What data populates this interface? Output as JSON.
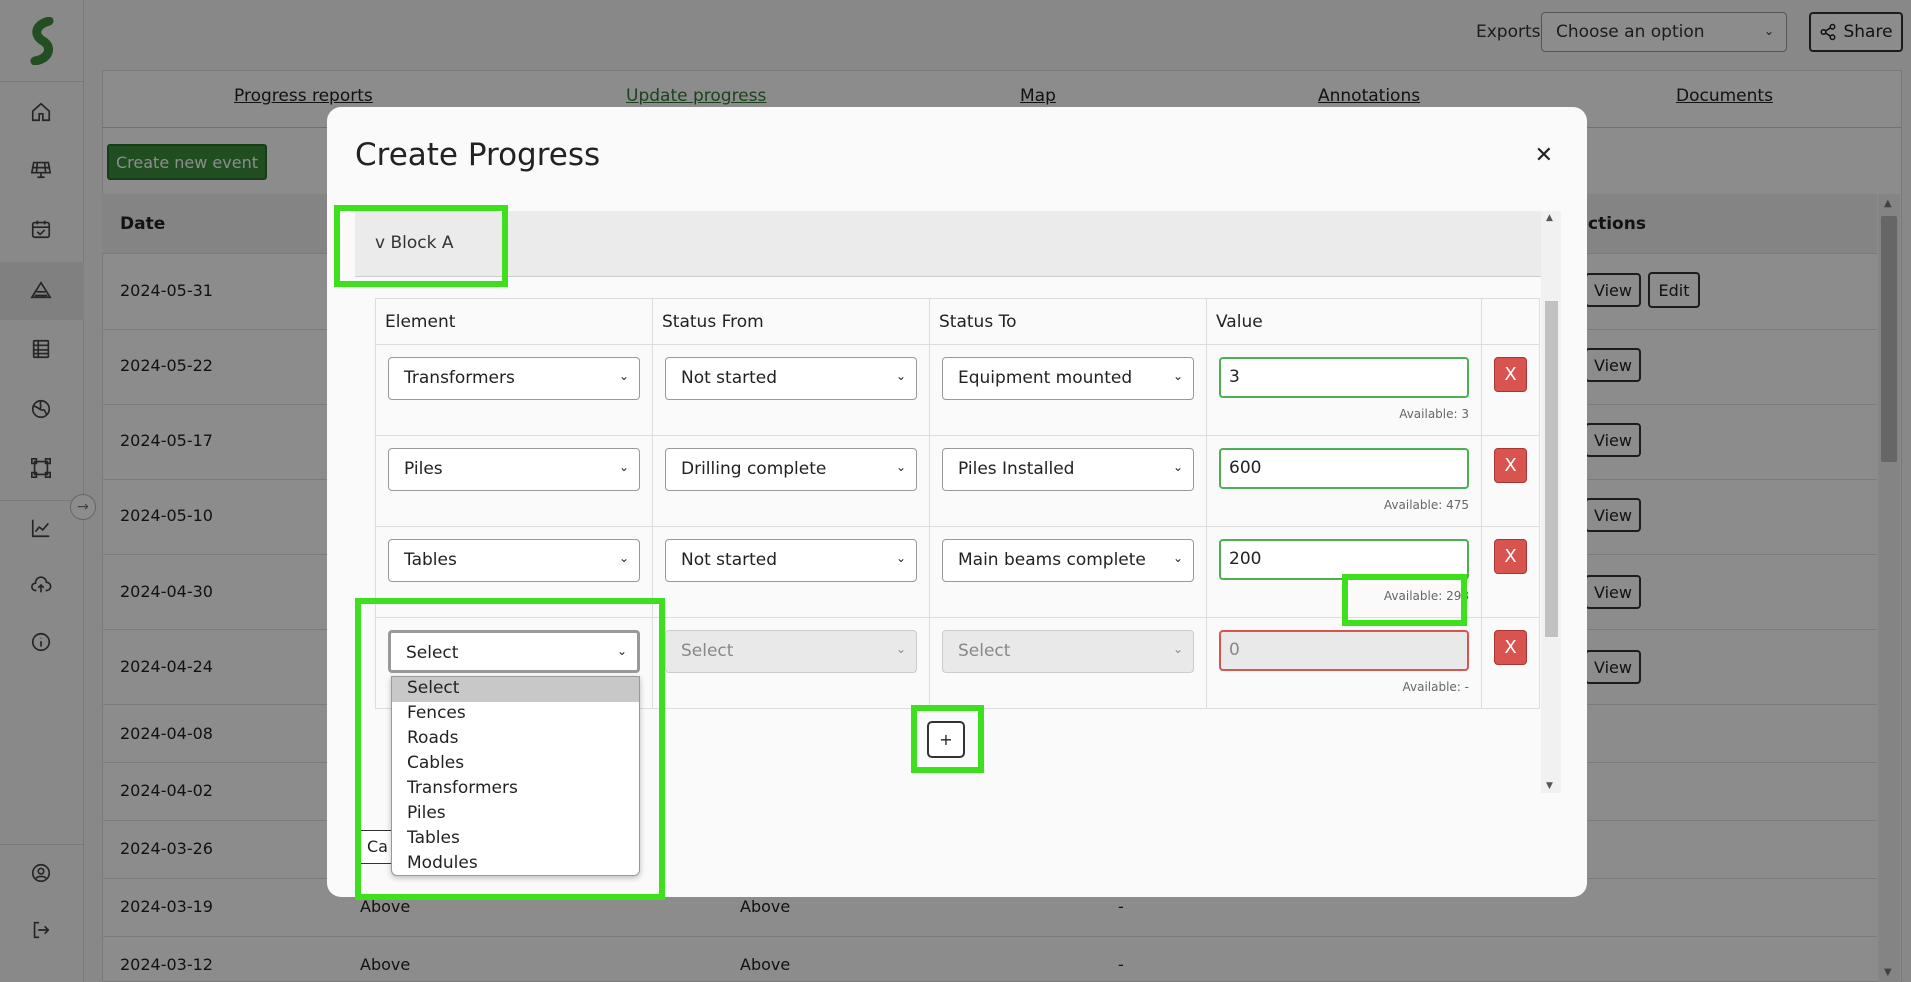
{
  "topbar": {
    "exports_label": "Exports:",
    "exports_value": "Choose an option",
    "share_label": "Share"
  },
  "main_tabs": [
    "Progress reports",
    "Update progress",
    "Map",
    "Annotations",
    "Documents"
  ],
  "create_event_label": "Create new event",
  "table": {
    "headers": {
      "date": "Date",
      "actions": "ctions"
    },
    "rows": [
      {
        "date": "2024-05-31"
      },
      {
        "date": "2024-05-22"
      },
      {
        "date": "2024-05-17"
      },
      {
        "date": "2024-05-10"
      },
      {
        "date": "2024-04-30"
      },
      {
        "date": "2024-04-24"
      },
      {
        "date": "2024-04-08"
      },
      {
        "date": "2024-04-02"
      },
      {
        "date": "2024-03-26"
      },
      {
        "date": "2024-03-19",
        "c1": "Above",
        "c2": "Above",
        "c3": "-"
      },
      {
        "date": "2024-03-12",
        "c1": "Above",
        "c2": "Above",
        "c3": "-"
      }
    ],
    "view_label": "View",
    "edit_label": "Edit"
  },
  "modal": {
    "title": "Create Progress",
    "close_glyph": "✕",
    "block_label": "v  Block A",
    "columns": [
      "Element",
      "Status From",
      "Status To",
      "Value"
    ],
    "rows": [
      {
        "element": "Transformers",
        "status_from": "Not started",
        "status_to": "Equipment mounted",
        "value": "3",
        "available": "Available: 3"
      },
      {
        "element": "Piles",
        "status_from": "Drilling complete",
        "status_to": "Piles Installed",
        "value": "600",
        "available": "Available: 475"
      },
      {
        "element": "Tables",
        "status_from": "Not started",
        "status_to": "Main beams complete",
        "value": "200",
        "available": "Available: 298"
      },
      {
        "element": "Select",
        "status_from": "Select",
        "status_to": "Select",
        "value": "0",
        "available": "Available: -"
      }
    ],
    "delete_label": "X",
    "add_label": "+",
    "cancel_label": "Ca",
    "dropdown_options": [
      "Select",
      "Fences",
      "Roads",
      "Cables",
      "Transformers",
      "Piles",
      "Tables",
      "Modules"
    ]
  },
  "colors": {
    "accent_green": "#2e7d32",
    "highlight": "#3ee01e",
    "danger": "#d9534f"
  }
}
